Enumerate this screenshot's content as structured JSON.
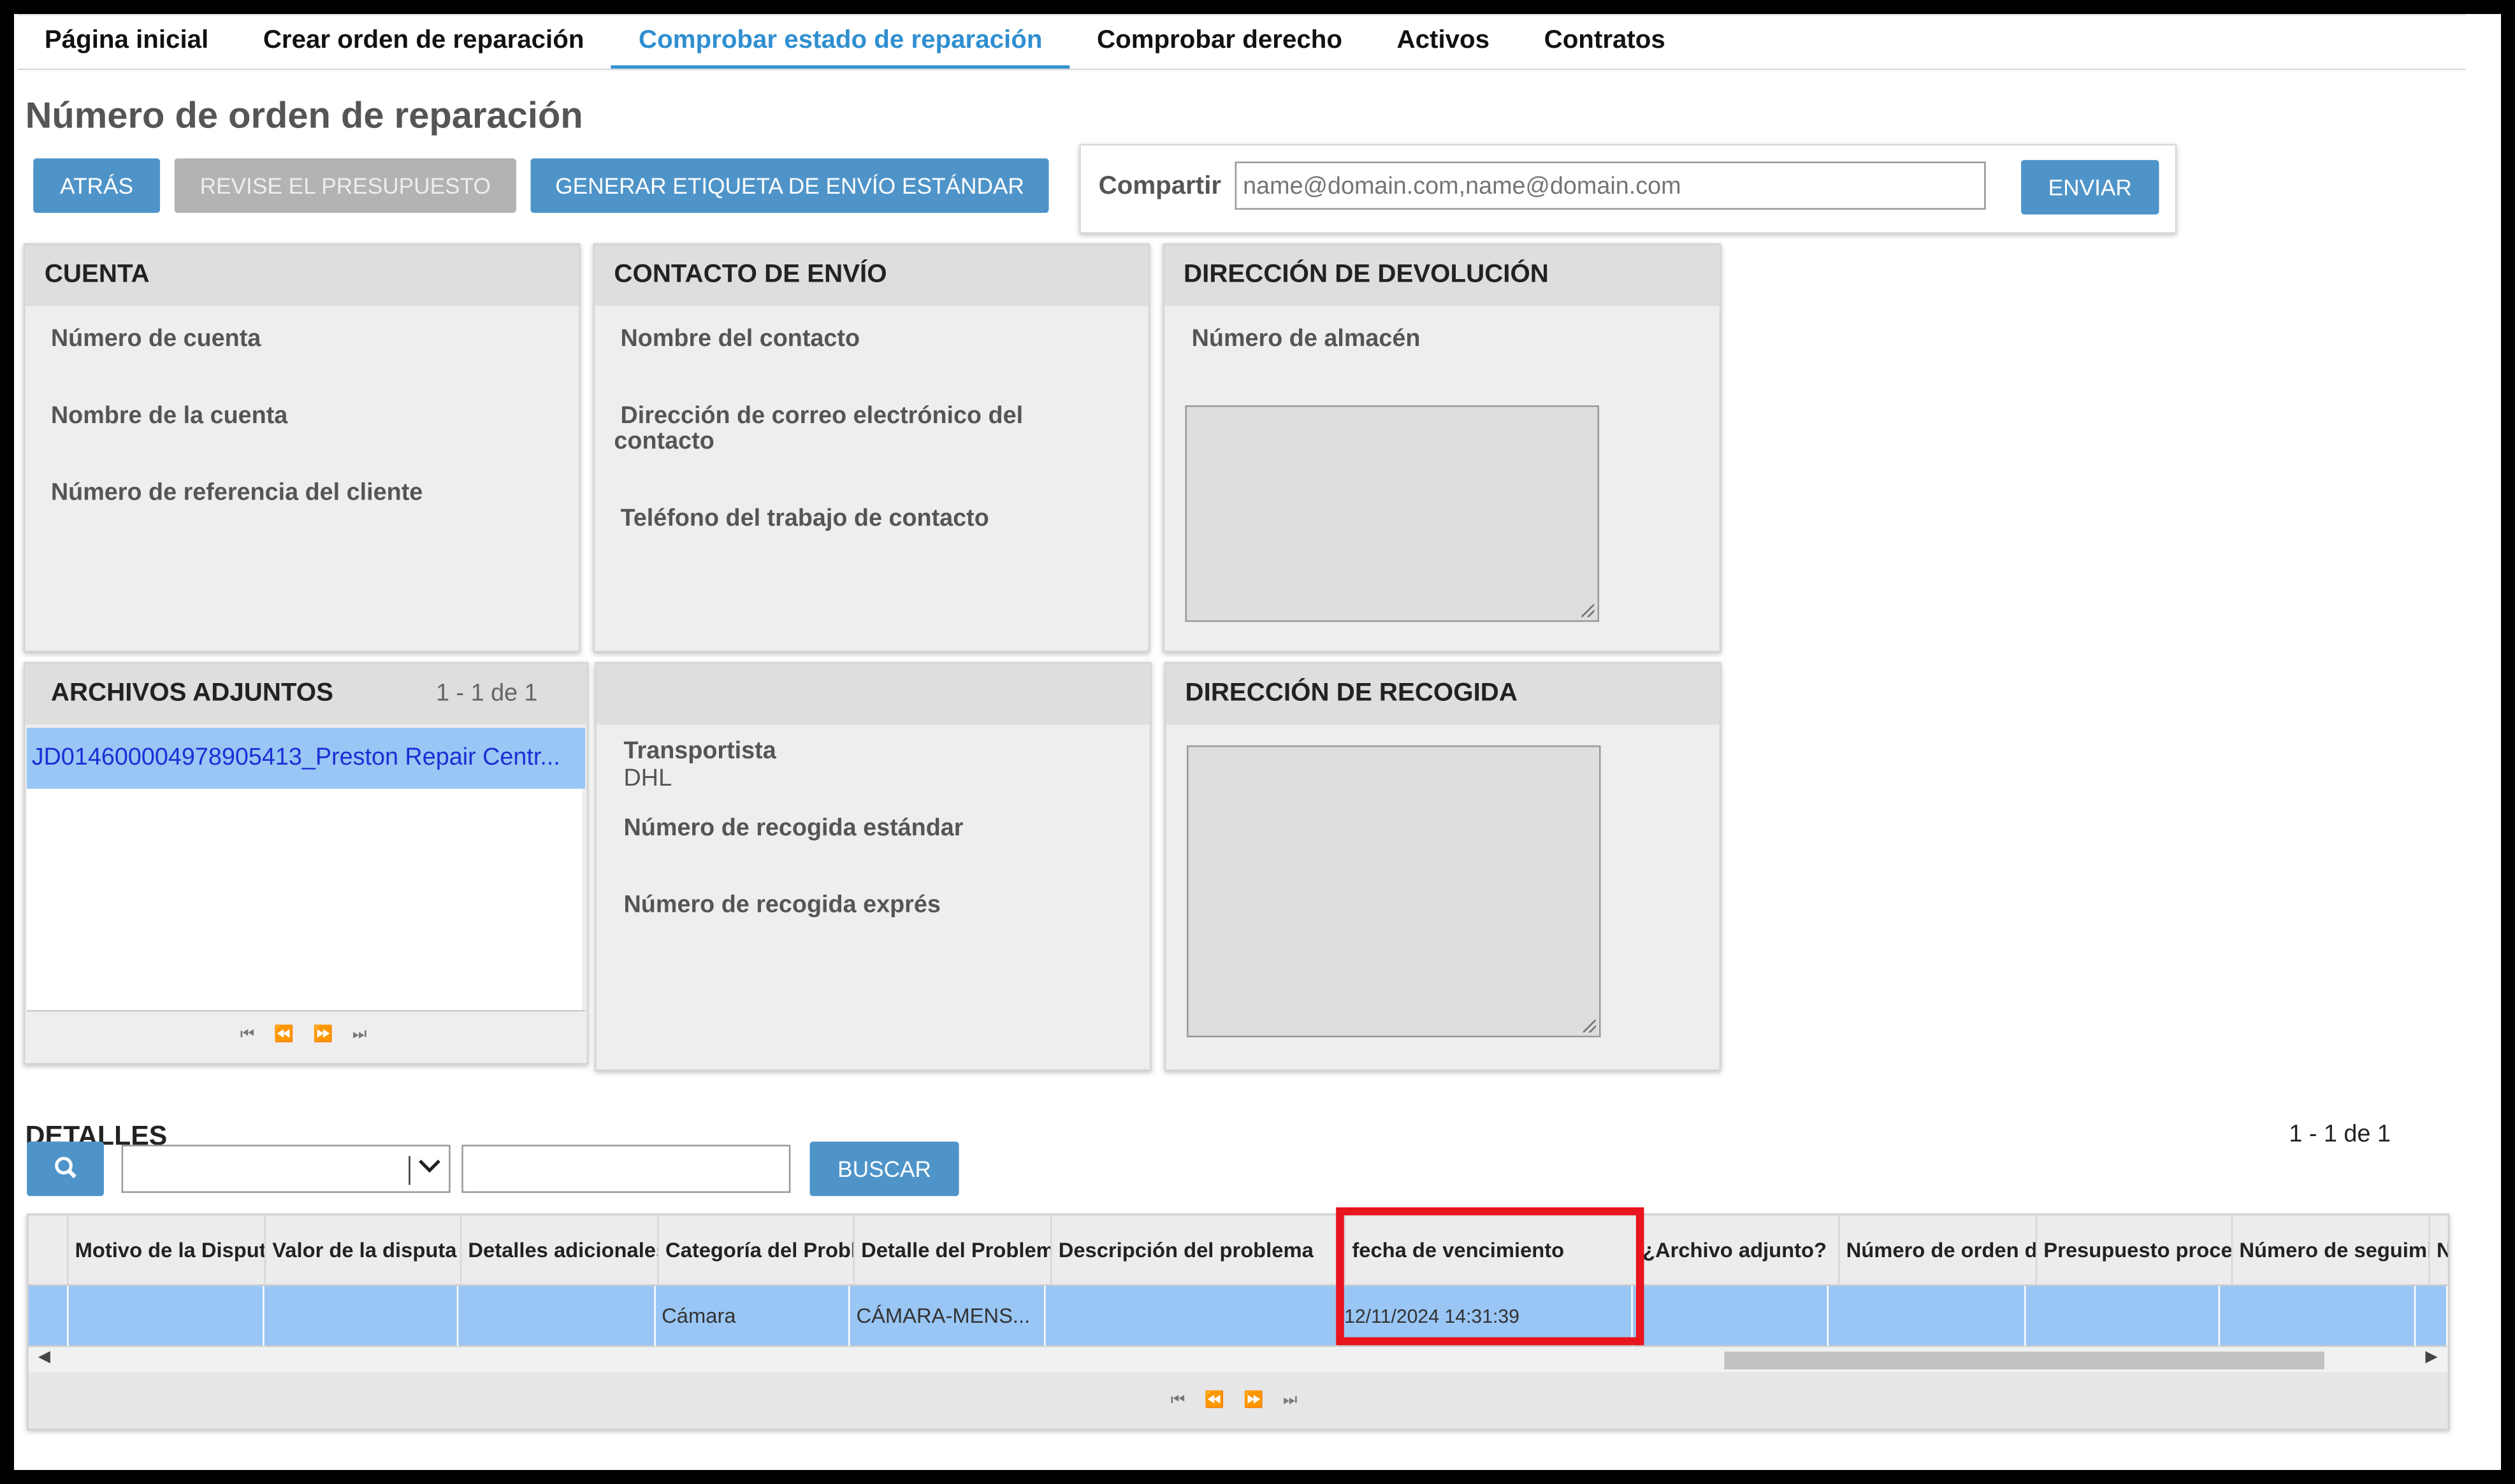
{
  "nav": {
    "tabs": [
      {
        "label": "Página inicial"
      },
      {
        "label": "Crear orden de reparación"
      },
      {
        "label": "Comprobar estado de reparación"
      },
      {
        "label": "Comprobar derecho"
      },
      {
        "label": "Activos"
      },
      {
        "label": "Contratos"
      }
    ],
    "active_index": 2,
    "active_color": "#2f8fd0"
  },
  "page_title": "Número de orden de reparación",
  "toolbar": {
    "back_label": "ATRÁS",
    "review_label": "REVISE EL PRESUPUESTO",
    "generate_label": "GENERAR ETIQUETA DE ENVÍO ESTÁNDAR"
  },
  "share": {
    "label": "Compartir",
    "placeholder": "name@domain.com,name@domain.com",
    "send_label": "ENVIAR"
  },
  "account": {
    "title": "CUENTA",
    "fields": [
      "Número de cuenta",
      "Nombre de la cuenta",
      "Número de referencia del cliente"
    ]
  },
  "shipping_contact": {
    "title": "CONTACTO DE ENVÍO",
    "contact_name": "Nombre del contacto",
    "email_line1": "Dirección de correo electrónico del",
    "email_line2": "contacto",
    "phone": "Teléfono del trabajo de contacto"
  },
  "return_address": {
    "title": "DIRECCIÓN DE DEVOLUCIÓN",
    "warehouse": "Número de almacén"
  },
  "attachments": {
    "title": "ARCHIVOS ADJUNTOS",
    "count": "1 - 1 de 1",
    "items": [
      "JD014600004978905413_Preston Repair Centr..."
    ]
  },
  "carrier": {
    "carrier_label": "Transportista",
    "carrier_value": "DHL",
    "standard_pickup": "Número de recogida estándar",
    "express_pickup": "Número de recogida exprés"
  },
  "pickup_address": {
    "title": "DIRECCIÓN DE RECOGIDA"
  },
  "details": {
    "title": "DETALLES",
    "count": "1 - 1 de 1",
    "search_label": "BUSCAR",
    "columns": [
      "Motivo de la Disputa",
      "Valor de la disputa",
      "Detalles adicionales",
      "Categoría del Problema",
      "Detalle del Problema",
      "Descripción del problema",
      "fecha de vencimiento",
      "¿Archivo adjunto?",
      "Número de orden de",
      "Presupuesto proce",
      "Número de seguimi",
      "N"
    ],
    "rows": [
      [
        "",
        "",
        "",
        "Cámara",
        "CÁMARA-MENS...",
        "",
        "12/11/2024 14:31:39",
        "",
        "",
        "",
        "",
        ""
      ]
    ]
  },
  "colors": {
    "button": "#4f94c9",
    "button_disabled": "#b3b3b3",
    "selection": "#99c6f4",
    "link": "#1a2fd6",
    "highlight": "#e8141e"
  }
}
